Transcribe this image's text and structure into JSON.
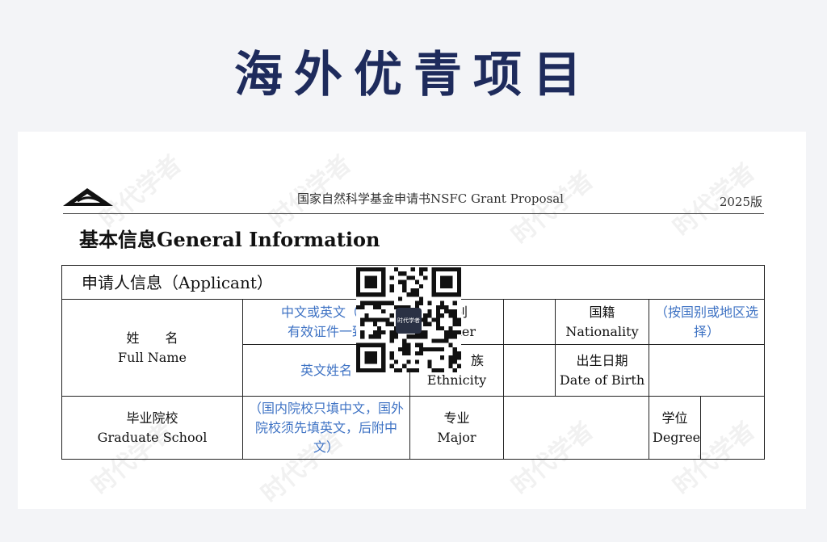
{
  "banner": {
    "title": "海外优青项目"
  },
  "document": {
    "proposal_title": "国家自然科学基金申请书NSFC Grant Proposal",
    "edition": "2025版",
    "section_title": "基本信息General Information"
  },
  "table": {
    "header": "申请人信息（Applicant）",
    "full_name_zh": "姓　　名",
    "full_name_en": "Full Name",
    "name_hint_1": "中文或英文（与",
    "name_hint_2": "有效证件一致",
    "gender_zh": "别",
    "gender_en": "ler",
    "nationality_zh": "国籍",
    "nationality_en": "Nationality",
    "nationality_hint": "（按国别或地区选择）",
    "english_name_hint": "英文姓名",
    "ethnicity_zh": "族",
    "ethnicity_en": "Ethnicity",
    "dob_zh": "出生日期",
    "dob_en": "Date of Birth",
    "school_zh": "毕业院校",
    "school_en": "Graduate School",
    "school_hint": "（国内院校只填中文，国外院校须先填英文，后附中文）",
    "major_zh": "专业",
    "major_en": "Major",
    "degree_zh": "学位",
    "degree_en": "Degree"
  },
  "watermark": {
    "text": "时代学者"
  },
  "qr": {
    "badge_text": "时代学者"
  }
}
